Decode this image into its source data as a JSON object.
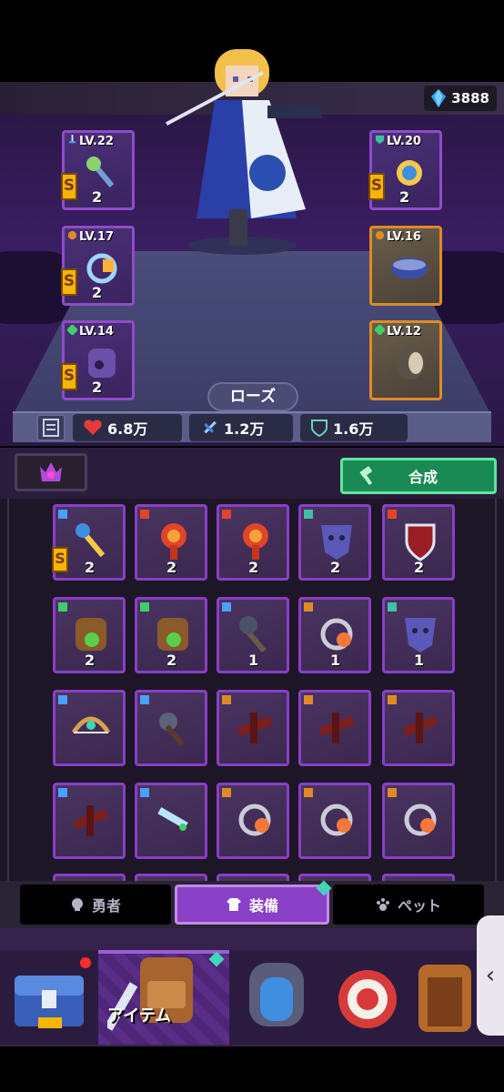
{
  "currency": {
    "gems": "3888",
    "icon": "blue-gem-icon"
  },
  "hero": {
    "name": "ローズ",
    "stats": {
      "hp": "6.8万",
      "atk": "1.2万",
      "def": "1.6万"
    },
    "equipped": [
      {
        "side": "left",
        "level": "LV.22",
        "count": "2",
        "item": "staff-icon"
      },
      {
        "side": "left",
        "level": "LV.17",
        "count": "2",
        "item": "ring-icon"
      },
      {
        "side": "left",
        "level": "LV.14",
        "count": "2",
        "item": "purple-glove-icon"
      },
      {
        "side": "right",
        "level": "LV.20",
        "count": "2",
        "item": "amulet-icon"
      },
      {
        "side": "right",
        "level": "LV.16",
        "count": "",
        "item": "bracelet-icon"
      },
      {
        "side": "right",
        "level": "LV.12",
        "count": "",
        "item": "boot-icon"
      }
    ]
  },
  "inventory": {
    "fuse_label": "合成",
    "rows": [
      [
        {
          "count": "2",
          "item": "golden-staff-icon"
        },
        {
          "count": "2",
          "item": "fire-scroll-icon"
        },
        {
          "count": "2",
          "item": "fire-scroll-icon"
        },
        {
          "count": "2",
          "item": "mask-icon"
        },
        {
          "count": "2",
          "item": "shield-icon"
        }
      ],
      [
        {
          "count": "2",
          "item": "green-glove-icon"
        },
        {
          "count": "2",
          "item": "green-glove-icon"
        },
        {
          "count": "1",
          "item": "mace-icon"
        },
        {
          "count": "1",
          "item": "ring-icon"
        },
        {
          "count": "1",
          "item": "mask-icon"
        }
      ],
      [
        {
          "count": "",
          "item": "bow-icon"
        },
        {
          "count": "",
          "item": "spiked-mace-icon"
        },
        {
          "count": "",
          "item": "crossbow-icon"
        },
        {
          "count": "",
          "item": "crossbow-icon"
        },
        {
          "count": "",
          "item": "crossbow-icon"
        }
      ],
      [
        {
          "count": "",
          "item": "crossbow-icon"
        },
        {
          "count": "",
          "item": "dagger-icon"
        },
        {
          "count": "",
          "item": "ring-icon"
        },
        {
          "count": "",
          "item": "ring-icon"
        },
        {
          "count": "",
          "item": "ring-icon"
        }
      ]
    ]
  },
  "tabs": [
    {
      "label": "勇者",
      "icon": "skull-icon"
    },
    {
      "label": "装備",
      "icon": "shirt-icon"
    },
    {
      "label": "ペット",
      "icon": "paw-icon"
    }
  ],
  "nav": {
    "active_label": "アイテム"
  },
  "colors": {
    "purple_border": "#8a3ec6",
    "orange_border": "#e08a26",
    "fuse_green": "#1a8a54",
    "gem": "#2aa8ff"
  }
}
